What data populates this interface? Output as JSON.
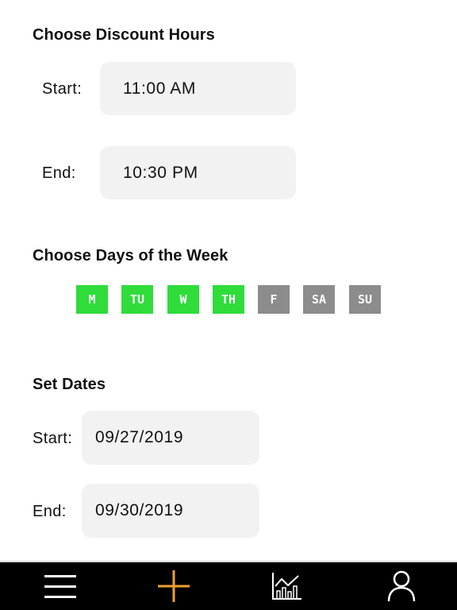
{
  "discount_hours": {
    "title": "Choose Discount Hours",
    "start_label": "Start:",
    "start_value": "11:00 AM",
    "end_label": "End:",
    "end_value": "10:30 PM"
  },
  "days_of_week": {
    "title": "Choose Days of the Week",
    "days": [
      {
        "label": "M",
        "selected": true
      },
      {
        "label": "TU",
        "selected": true
      },
      {
        "label": "W",
        "selected": true
      },
      {
        "label": "TH",
        "selected": true
      },
      {
        "label": "F",
        "selected": false
      },
      {
        "label": "SA",
        "selected": false
      },
      {
        "label": "SU",
        "selected": false
      }
    ],
    "selected_color": "#2fdc3a",
    "unselected_color": "#8c8c8c"
  },
  "set_dates": {
    "title": "Set Dates",
    "start_label": "Start:",
    "start_value": "09/27/2019",
    "end_label": "End:",
    "end_value": "09/30/2019"
  },
  "bottom_nav": {
    "items": [
      {
        "icon": "menu-icon"
      },
      {
        "icon": "add-icon",
        "color": "#f0a030"
      },
      {
        "icon": "chart-icon"
      },
      {
        "icon": "profile-icon"
      }
    ]
  }
}
